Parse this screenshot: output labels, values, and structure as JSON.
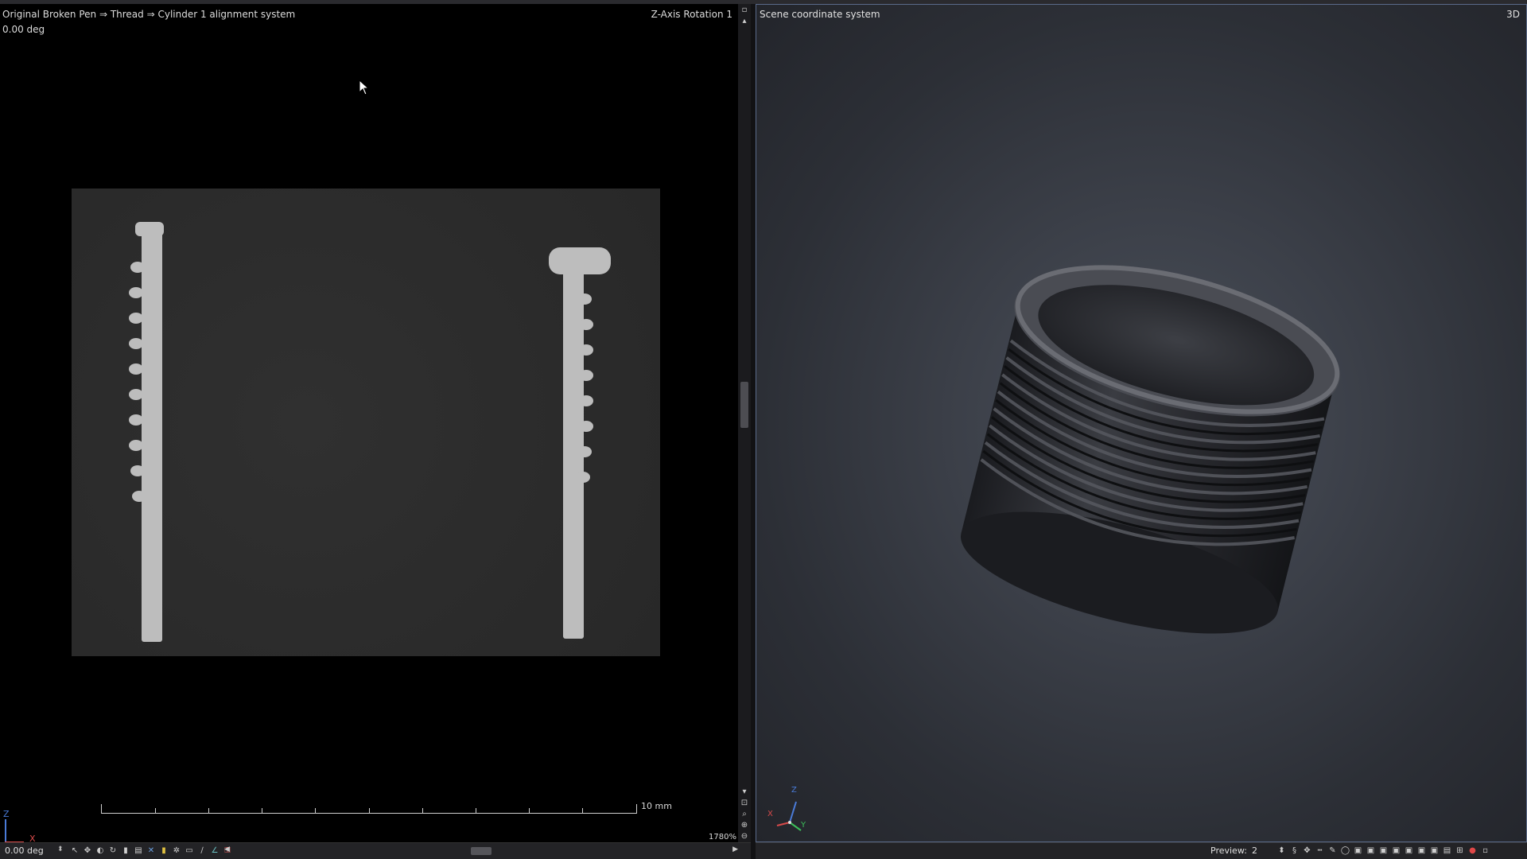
{
  "slice_view": {
    "breadcrumb": "Original Broken Pen ⇒ Thread ⇒ Cylinder 1 alignment system",
    "angle": "0.00 deg",
    "view_label": "Z-Axis Rotation 1",
    "scale_label": "10 mm",
    "zoom_label": "1780%",
    "axis_z": "Z",
    "axis_x": "X"
  },
  "slice_toolbar": {
    "angle_value": "0.00 deg",
    "icons": [
      "pointer-icon",
      "pan-icon",
      "contrast-icon",
      "rotate-icon",
      "window-icon",
      "measure-icon",
      "color-icon",
      "select-icon",
      "settings-icon",
      "ruler-icon",
      "line-icon",
      "angle-icon",
      "lock-icon"
    ]
  },
  "scene_view": {
    "title": "Scene coordinate system",
    "mode": "3D",
    "axis_z": "Z",
    "axis_x": "X",
    "axis_y": "Y"
  },
  "scene_toolbar": {
    "preview_label": "Preview:",
    "preview_value": "2",
    "icons": [
      "spin-icon",
      "sync-icon",
      "pan-icon",
      "ruler-icon",
      "pen-icon",
      "sphere-icon",
      "cube-front-icon",
      "cube-back-icon",
      "cube-left-icon",
      "cube-right-icon",
      "cube-top-icon",
      "cube-bottom-icon",
      "cube-iso-icon",
      "layout-icon",
      "grid-icon",
      "record-icon",
      "fullscreen-icon"
    ]
  },
  "colors": {
    "axis_x": "#d84a4a",
    "axis_y": "#3cc05a",
    "axis_z": "#4a7bd8",
    "pane_border": "#5a6a8a"
  }
}
